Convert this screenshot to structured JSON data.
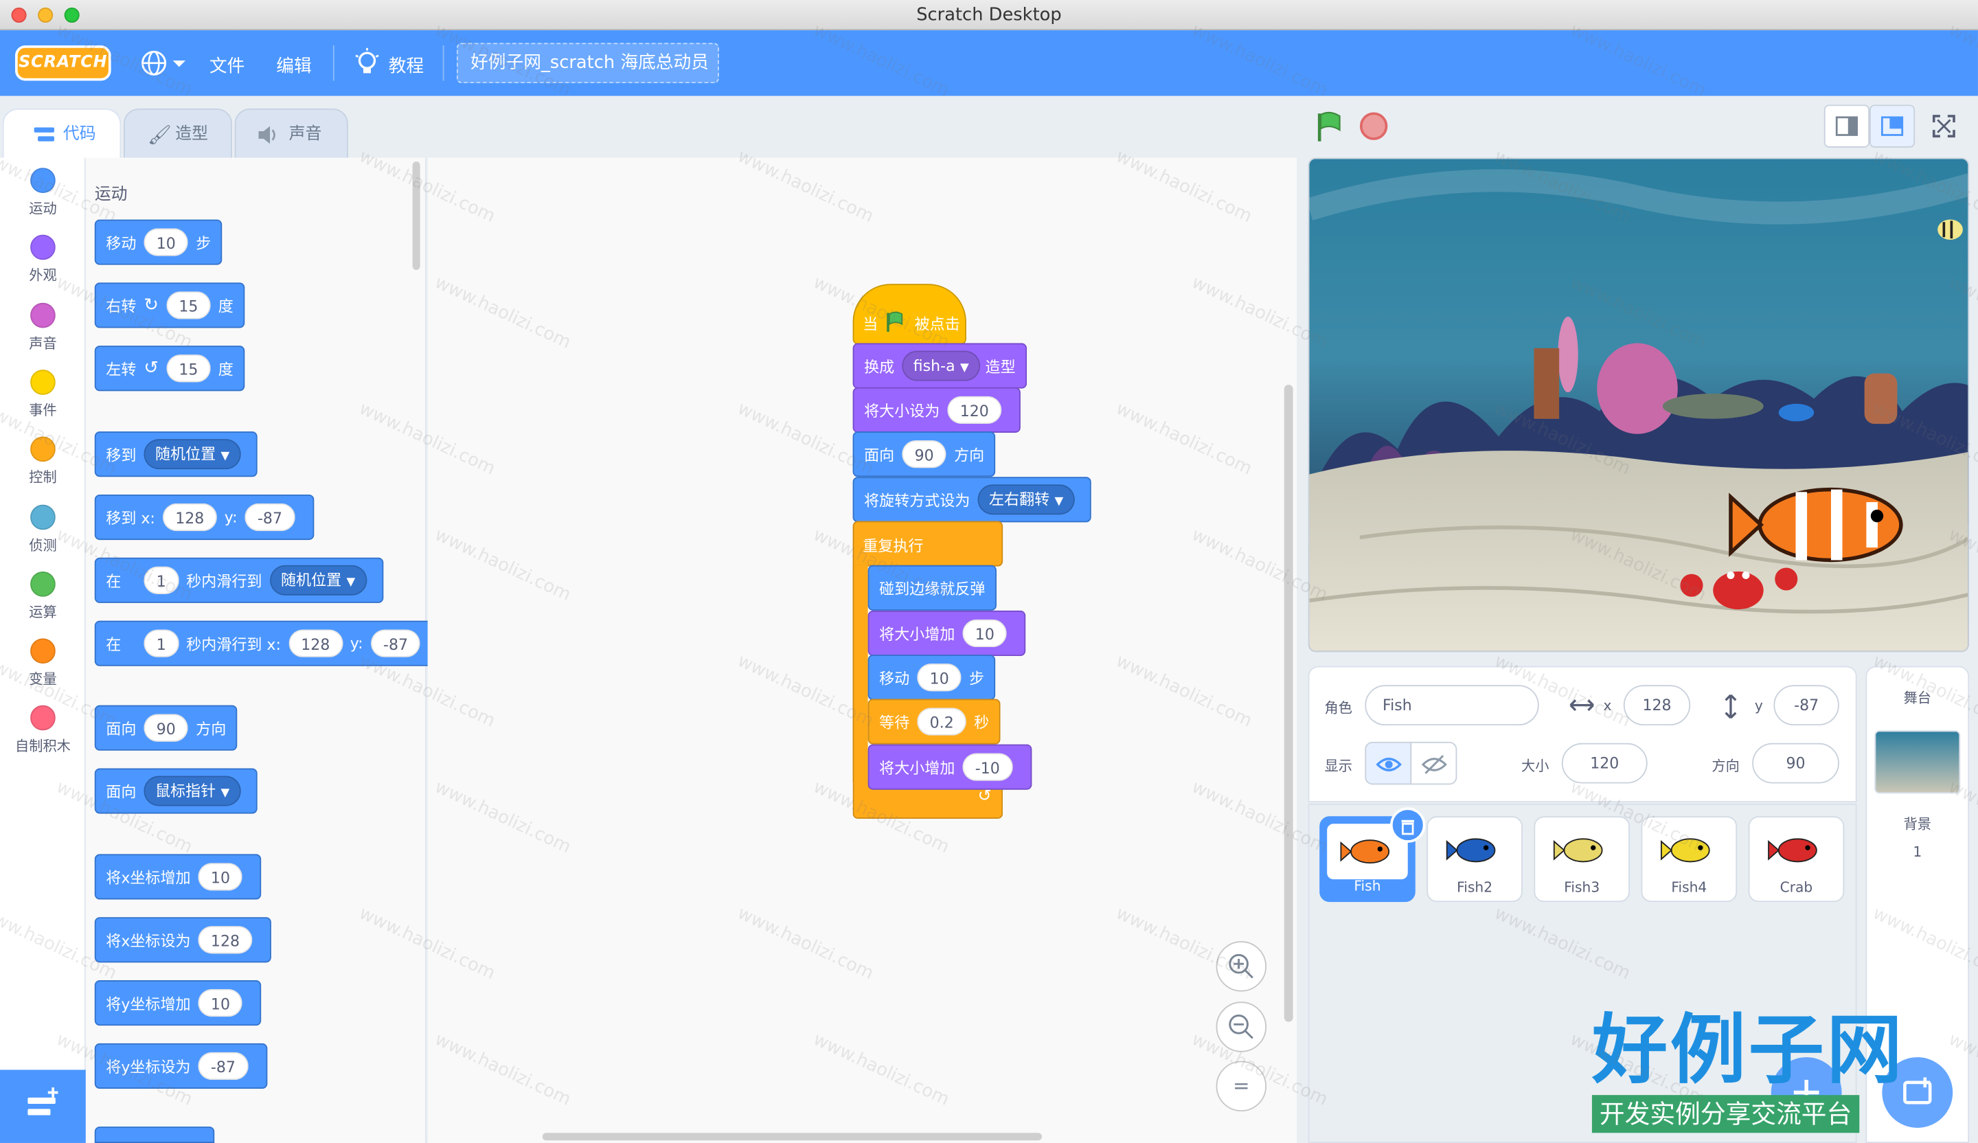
{
  "window": {
    "title": "Scratch Desktop"
  },
  "menu": {
    "logo": "SCRATCH",
    "file": "文件",
    "edit": "编辑",
    "tutorials": "教程",
    "project_title": "好例子网_scratch 海底总动员"
  },
  "tabs": {
    "code": "代码",
    "costumes": "造型",
    "sounds": "声音"
  },
  "categories": [
    {
      "label": "运动",
      "color": "#4c97ff"
    },
    {
      "label": "外观",
      "color": "#9966ff"
    },
    {
      "label": "声音",
      "color": "#cf63cf"
    },
    {
      "label": "事件",
      "color": "#ffd500"
    },
    {
      "label": "控制",
      "color": "#ffab19"
    },
    {
      "label": "侦测",
      "color": "#5cb1d6"
    },
    {
      "label": "运算",
      "color": "#59c059"
    },
    {
      "label": "变量",
      "color": "#ff8c1a"
    },
    {
      "label": "自制积木",
      "color": "#ff6680"
    }
  ],
  "palette": {
    "section_title": "运动",
    "move": {
      "label": "移动",
      "value": "10",
      "unit": "步"
    },
    "turn_right": {
      "label": "右转",
      "value": "15",
      "unit": "度"
    },
    "turn_left": {
      "label": "左转",
      "value": "15",
      "unit": "度"
    },
    "goto": {
      "label": "移到",
      "option": "随机位置"
    },
    "goto_xy": {
      "label": "移到 x:",
      "x": "128",
      "ylabel": "y:",
      "y": "-87"
    },
    "glide": {
      "label": "在",
      "secs": "1",
      "mid": "秒内滑行到",
      "option": "随机位置"
    },
    "glide_xy": {
      "label": "在",
      "secs": "1",
      "mid": "秒内滑行到 x:",
      "x": "128",
      "ylabel": "y:",
      "y": "-87"
    },
    "point_dir": {
      "label": "面向",
      "value": "90",
      "unit": "方向"
    },
    "point_towards": {
      "label": "面向",
      "option": "鼠标指针"
    },
    "change_x": {
      "label": "将x坐标增加",
      "value": "10"
    },
    "set_x": {
      "label": "将x坐标设为",
      "value": "128"
    },
    "change_y": {
      "label": "将y坐标增加",
      "value": "10"
    },
    "set_y": {
      "label": "将y坐标设为",
      "value": "-87"
    }
  },
  "script": {
    "when_flag": {
      "pre": "当",
      "post": "被点击"
    },
    "switch_costume": {
      "label": "换成",
      "option": "fish-a",
      "unit": "造型"
    },
    "set_size": {
      "label": "将大小设为",
      "value": "120"
    },
    "point_dir": {
      "label": "面向",
      "value": "90",
      "unit": "方向"
    },
    "rotation_style": {
      "label": "将旋转方式设为",
      "option": "左右翻转"
    },
    "forever": {
      "label": "重复执行"
    },
    "bounce": {
      "label": "碰到边缘就反弹"
    },
    "change_size_1": {
      "label": "将大小增加",
      "value": "10"
    },
    "move": {
      "label": "移动",
      "value": "10",
      "unit": "步"
    },
    "wait": {
      "label": "等待",
      "value": "0.2",
      "unit": "秒"
    },
    "change_size_2": {
      "label": "将大小增加",
      "value": "-10"
    }
  },
  "zoom": {
    "in": "+",
    "out": "−",
    "reset": "="
  },
  "sprite_info": {
    "sprite_label": "角色",
    "sprite_name": "Fish",
    "x_label": "x",
    "x": "128",
    "y_label": "y",
    "y": "-87",
    "show_label": "显示",
    "size_label": "大小",
    "size": "120",
    "direction_label": "方向",
    "direction": "90"
  },
  "sprites": [
    {
      "name": "Fish",
      "selected": true
    },
    {
      "name": "Fish2",
      "selected": false
    },
    {
      "name": "Fish3",
      "selected": false
    },
    {
      "name": "Fish4",
      "selected": false
    },
    {
      "name": "Crab",
      "selected": false
    }
  ],
  "stage_pane": {
    "title": "舞台",
    "backdrops_label": "背景",
    "backdrops_count": "1"
  },
  "watermark": {
    "text": "www.haolizi.com",
    "brand": "好例子网",
    "brand_sub": "开发实例分享交流平台"
  }
}
